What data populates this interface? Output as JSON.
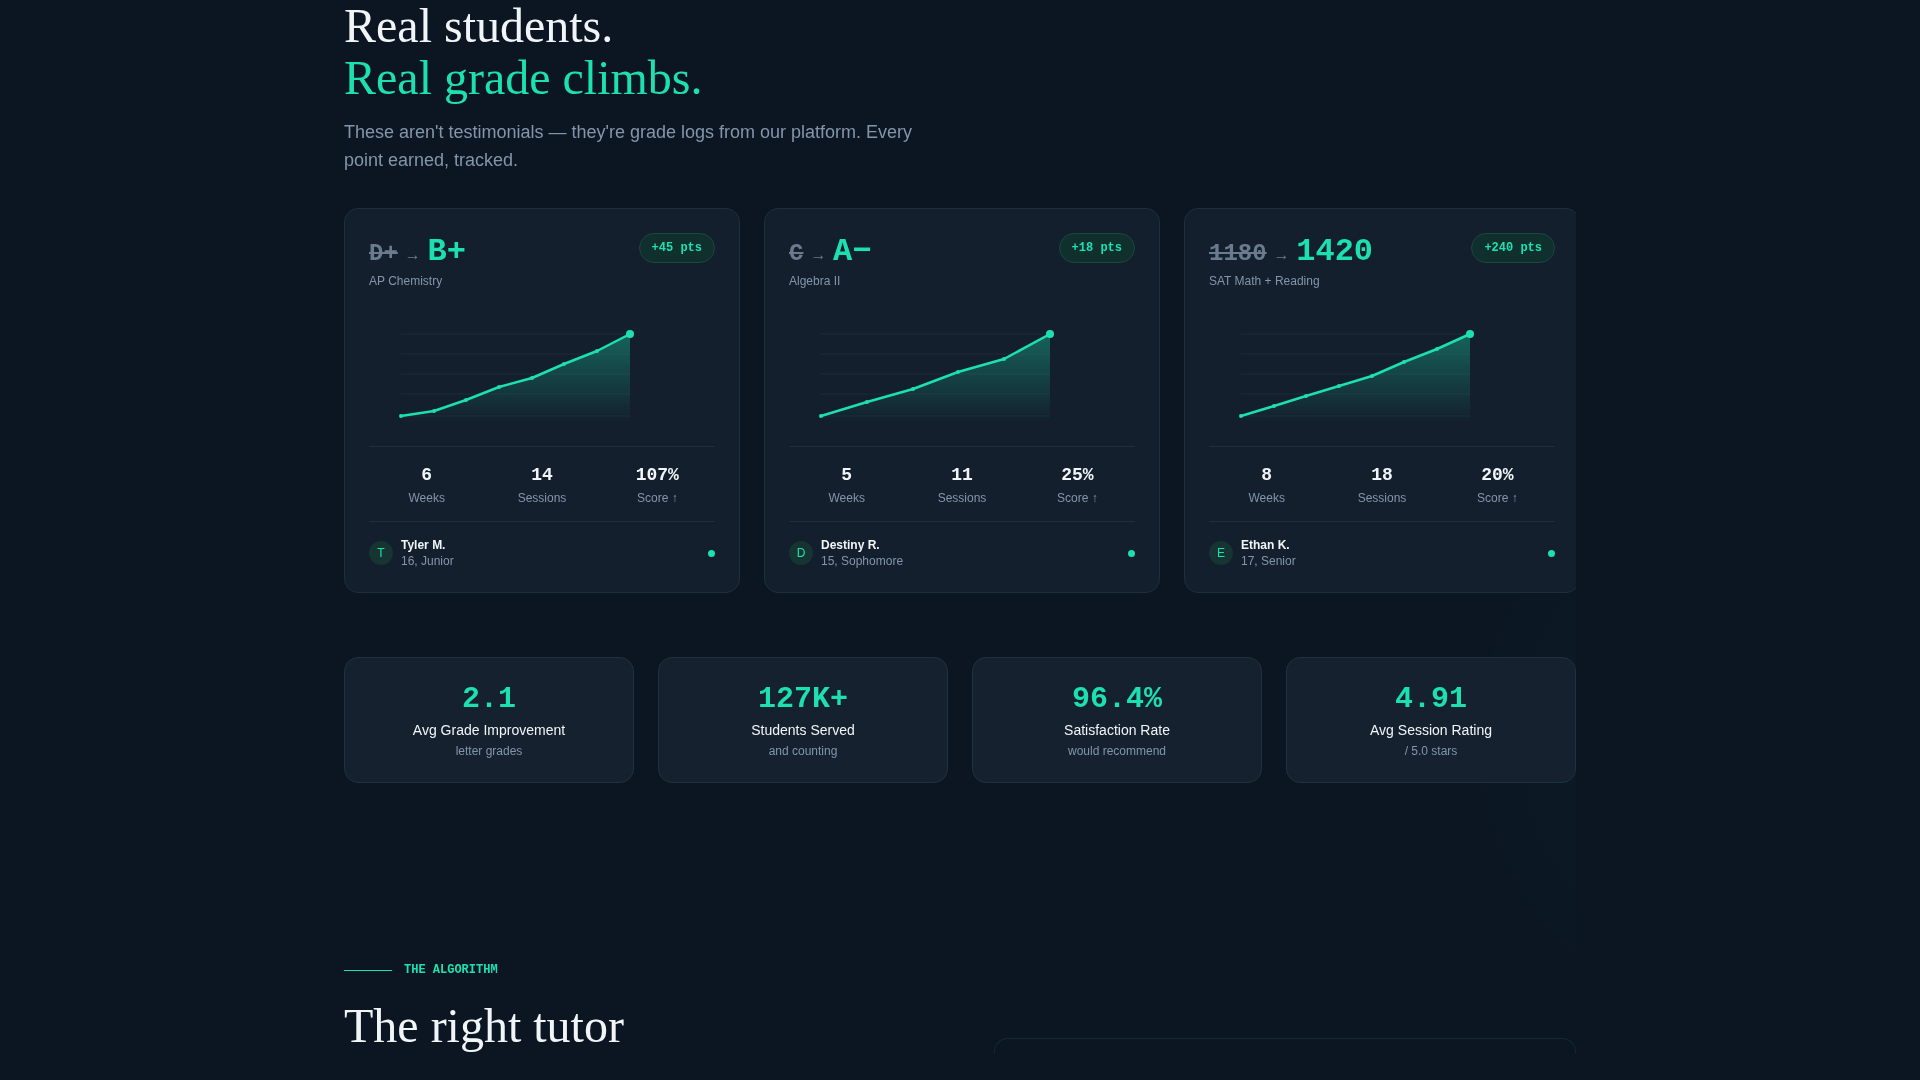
{
  "heading": {
    "line_1": "Real students.",
    "line_2": "Real grade climbs."
  },
  "intro": "These aren't testimonials — they're grade logs from our platform. Every point earned, tracked.",
  "cases": [
    {
      "from": "D+",
      "arrow": "→",
      "to": "B+",
      "gain": "+45 pts",
      "subject": "AP Chemistry",
      "stats": [
        {
          "value": "6",
          "label": "Weeks"
        },
        {
          "value": "14",
          "label": "Sessions"
        },
        {
          "value": "107%",
          "label": "Score ↑"
        }
      ],
      "student": {
        "initial": "T",
        "name": "Tyler M.",
        "detail": "16, Junior"
      }
    },
    {
      "from": "C",
      "arrow": "→",
      "to": "A−",
      "gain": "+18 pts",
      "subject": "Algebra II",
      "stats": [
        {
          "value": "5",
          "label": "Weeks"
        },
        {
          "value": "11",
          "label": "Sessions"
        },
        {
          "value": "25%",
          "label": "Score ↑"
        }
      ],
      "student": {
        "initial": "D",
        "name": "Destiny R.",
        "detail": "15, Sophomore"
      }
    },
    {
      "from": "1180",
      "arrow": "→",
      "to": "1420",
      "gain": "+240 pts",
      "subject": "SAT Math + Reading",
      "stats": [
        {
          "value": "8",
          "label": "Weeks"
        },
        {
          "value": "18",
          "label": "Sessions"
        },
        {
          "value": "20%",
          "label": "Score ↑"
        }
      ],
      "student": {
        "initial": "E",
        "name": "Ethan K.",
        "detail": "17, Senior"
      }
    }
  ],
  "metrics": [
    {
      "value": "2.1",
      "label": "Avg Grade Improvement",
      "note": "letter grades"
    },
    {
      "value": "127K+",
      "label": "Students Served",
      "note": "and counting"
    },
    {
      "value": "96.4%",
      "label": "Satisfaction Rate",
      "note": "would recommend"
    },
    {
      "value": "4.91",
      "label": "Avg Session Rating",
      "note": "/ 5.0 stars"
    }
  ],
  "next_section": {
    "eyebrow": "THE ALGORITHM",
    "heading": "The right tutor"
  }
}
